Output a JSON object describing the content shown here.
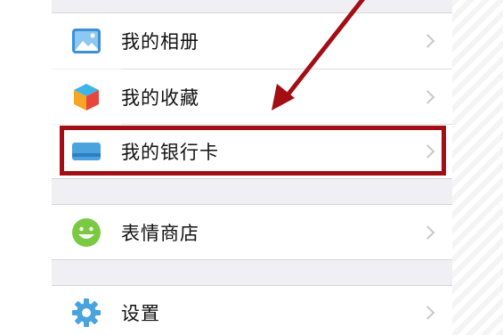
{
  "menu": {
    "rows": [
      {
        "label": "我的相册",
        "icon": "photo-album-icon"
      },
      {
        "label": "我的收藏",
        "icon": "favorites-cube-icon"
      },
      {
        "label": "我的银行卡",
        "icon": "bank-card-icon"
      },
      {
        "label": "表情商店",
        "icon": "smiley-face-icon"
      },
      {
        "label": "设置",
        "icon": "gear-icon"
      }
    ]
  },
  "colors": {
    "highlight": "#a30d14",
    "panel_background": "#efeff4",
    "chevron": "#c7c7cc",
    "icon_blue": "#4aa3df",
    "icon_green": "#7ac943"
  }
}
